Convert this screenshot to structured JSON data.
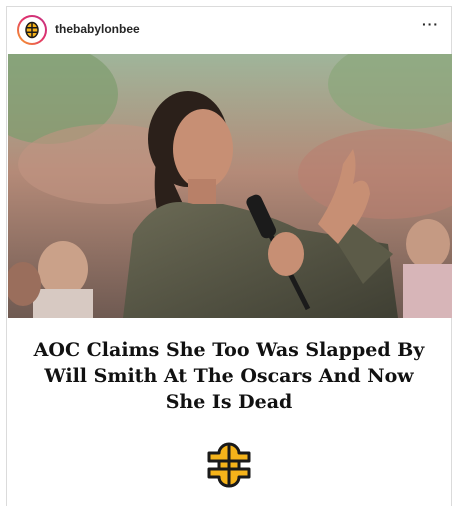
{
  "post": {
    "username": "thebabylonbee",
    "more_icon": "more-horizontal-icon",
    "more_glyph": "···",
    "headline": "AOC Claims She Too Was Slapped By Will Smith At The Oscars And Now She Is Dead"
  },
  "colors": {
    "logo_yellow": "#f5b31a",
    "logo_dark": "#1a1a1a",
    "border": "#dbdbdb",
    "text": "#262626"
  }
}
